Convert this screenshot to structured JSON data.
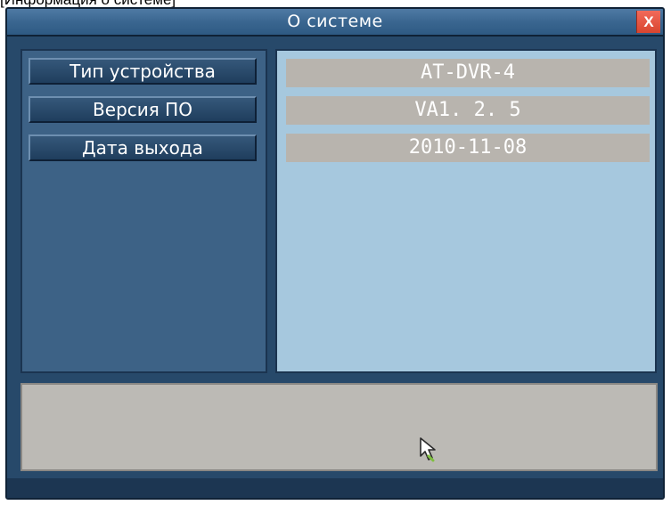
{
  "caption": "[Информация о системе]",
  "window": {
    "title": "О системе",
    "close_label": "X"
  },
  "labels": [
    "Тип устройства",
    "Версия ПО",
    "Дата выхода"
  ],
  "values": [
    "AT-DVR-4",
    "VA1. 2. 5",
    "2010-11-08"
  ],
  "colors": {
    "window_bg": "#27496a",
    "left_panel_bg": "#3d6286",
    "right_panel_bg": "#a6c8de",
    "value_field_bg": "#b8b4ae",
    "status_bg": "#bcbab5",
    "close_button_bg": "#d8452f"
  },
  "icons": {
    "pointer": "mouse-cursor-icon"
  }
}
